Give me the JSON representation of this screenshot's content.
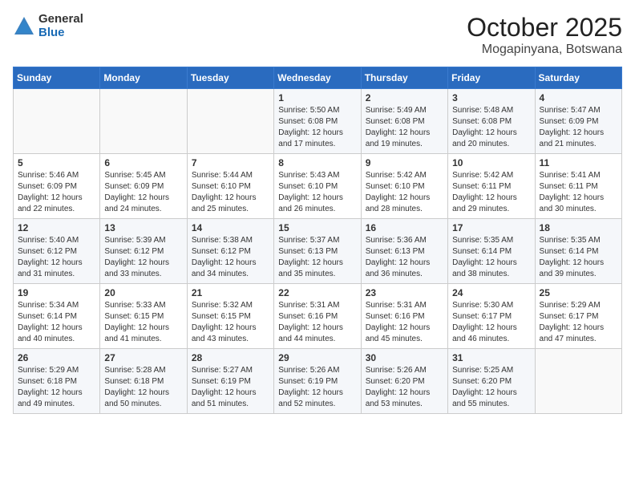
{
  "logo": {
    "general": "General",
    "blue": "Blue"
  },
  "header": {
    "month": "October 2025",
    "location": "Mogapinyana, Botswana"
  },
  "weekdays": [
    "Sunday",
    "Monday",
    "Tuesday",
    "Wednesday",
    "Thursday",
    "Friday",
    "Saturday"
  ],
  "weeks": [
    [
      {
        "day": "",
        "sunrise": "",
        "sunset": "",
        "daylight": ""
      },
      {
        "day": "",
        "sunrise": "",
        "sunset": "",
        "daylight": ""
      },
      {
        "day": "",
        "sunrise": "",
        "sunset": "",
        "daylight": ""
      },
      {
        "day": "1",
        "sunrise": "Sunrise: 5:50 AM",
        "sunset": "Sunset: 6:08 PM",
        "daylight": "Daylight: 12 hours and 17 minutes."
      },
      {
        "day": "2",
        "sunrise": "Sunrise: 5:49 AM",
        "sunset": "Sunset: 6:08 PM",
        "daylight": "Daylight: 12 hours and 19 minutes."
      },
      {
        "day": "3",
        "sunrise": "Sunrise: 5:48 AM",
        "sunset": "Sunset: 6:08 PM",
        "daylight": "Daylight: 12 hours and 20 minutes."
      },
      {
        "day": "4",
        "sunrise": "Sunrise: 5:47 AM",
        "sunset": "Sunset: 6:09 PM",
        "daylight": "Daylight: 12 hours and 21 minutes."
      }
    ],
    [
      {
        "day": "5",
        "sunrise": "Sunrise: 5:46 AM",
        "sunset": "Sunset: 6:09 PM",
        "daylight": "Daylight: 12 hours and 22 minutes."
      },
      {
        "day": "6",
        "sunrise": "Sunrise: 5:45 AM",
        "sunset": "Sunset: 6:09 PM",
        "daylight": "Daylight: 12 hours and 24 minutes."
      },
      {
        "day": "7",
        "sunrise": "Sunrise: 5:44 AM",
        "sunset": "Sunset: 6:10 PM",
        "daylight": "Daylight: 12 hours and 25 minutes."
      },
      {
        "day": "8",
        "sunrise": "Sunrise: 5:43 AM",
        "sunset": "Sunset: 6:10 PM",
        "daylight": "Daylight: 12 hours and 26 minutes."
      },
      {
        "day": "9",
        "sunrise": "Sunrise: 5:42 AM",
        "sunset": "Sunset: 6:10 PM",
        "daylight": "Daylight: 12 hours and 28 minutes."
      },
      {
        "day": "10",
        "sunrise": "Sunrise: 5:42 AM",
        "sunset": "Sunset: 6:11 PM",
        "daylight": "Daylight: 12 hours and 29 minutes."
      },
      {
        "day": "11",
        "sunrise": "Sunrise: 5:41 AM",
        "sunset": "Sunset: 6:11 PM",
        "daylight": "Daylight: 12 hours and 30 minutes."
      }
    ],
    [
      {
        "day": "12",
        "sunrise": "Sunrise: 5:40 AM",
        "sunset": "Sunset: 6:12 PM",
        "daylight": "Daylight: 12 hours and 31 minutes."
      },
      {
        "day": "13",
        "sunrise": "Sunrise: 5:39 AM",
        "sunset": "Sunset: 6:12 PM",
        "daylight": "Daylight: 12 hours and 33 minutes."
      },
      {
        "day": "14",
        "sunrise": "Sunrise: 5:38 AM",
        "sunset": "Sunset: 6:12 PM",
        "daylight": "Daylight: 12 hours and 34 minutes."
      },
      {
        "day": "15",
        "sunrise": "Sunrise: 5:37 AM",
        "sunset": "Sunset: 6:13 PM",
        "daylight": "Daylight: 12 hours and 35 minutes."
      },
      {
        "day": "16",
        "sunrise": "Sunrise: 5:36 AM",
        "sunset": "Sunset: 6:13 PM",
        "daylight": "Daylight: 12 hours and 36 minutes."
      },
      {
        "day": "17",
        "sunrise": "Sunrise: 5:35 AM",
        "sunset": "Sunset: 6:14 PM",
        "daylight": "Daylight: 12 hours and 38 minutes."
      },
      {
        "day": "18",
        "sunrise": "Sunrise: 5:35 AM",
        "sunset": "Sunset: 6:14 PM",
        "daylight": "Daylight: 12 hours and 39 minutes."
      }
    ],
    [
      {
        "day": "19",
        "sunrise": "Sunrise: 5:34 AM",
        "sunset": "Sunset: 6:14 PM",
        "daylight": "Daylight: 12 hours and 40 minutes."
      },
      {
        "day": "20",
        "sunrise": "Sunrise: 5:33 AM",
        "sunset": "Sunset: 6:15 PM",
        "daylight": "Daylight: 12 hours and 41 minutes."
      },
      {
        "day": "21",
        "sunrise": "Sunrise: 5:32 AM",
        "sunset": "Sunset: 6:15 PM",
        "daylight": "Daylight: 12 hours and 43 minutes."
      },
      {
        "day": "22",
        "sunrise": "Sunrise: 5:31 AM",
        "sunset": "Sunset: 6:16 PM",
        "daylight": "Daylight: 12 hours and 44 minutes."
      },
      {
        "day": "23",
        "sunrise": "Sunrise: 5:31 AM",
        "sunset": "Sunset: 6:16 PM",
        "daylight": "Daylight: 12 hours and 45 minutes."
      },
      {
        "day": "24",
        "sunrise": "Sunrise: 5:30 AM",
        "sunset": "Sunset: 6:17 PM",
        "daylight": "Daylight: 12 hours and 46 minutes."
      },
      {
        "day": "25",
        "sunrise": "Sunrise: 5:29 AM",
        "sunset": "Sunset: 6:17 PM",
        "daylight": "Daylight: 12 hours and 47 minutes."
      }
    ],
    [
      {
        "day": "26",
        "sunrise": "Sunrise: 5:29 AM",
        "sunset": "Sunset: 6:18 PM",
        "daylight": "Daylight: 12 hours and 49 minutes."
      },
      {
        "day": "27",
        "sunrise": "Sunrise: 5:28 AM",
        "sunset": "Sunset: 6:18 PM",
        "daylight": "Daylight: 12 hours and 50 minutes."
      },
      {
        "day": "28",
        "sunrise": "Sunrise: 5:27 AM",
        "sunset": "Sunset: 6:19 PM",
        "daylight": "Daylight: 12 hours and 51 minutes."
      },
      {
        "day": "29",
        "sunrise": "Sunrise: 5:26 AM",
        "sunset": "Sunset: 6:19 PM",
        "daylight": "Daylight: 12 hours and 52 minutes."
      },
      {
        "day": "30",
        "sunrise": "Sunrise: 5:26 AM",
        "sunset": "Sunset: 6:20 PM",
        "daylight": "Daylight: 12 hours and 53 minutes."
      },
      {
        "day": "31",
        "sunrise": "Sunrise: 5:25 AM",
        "sunset": "Sunset: 6:20 PM",
        "daylight": "Daylight: 12 hours and 55 minutes."
      },
      {
        "day": "",
        "sunrise": "",
        "sunset": "",
        "daylight": ""
      }
    ]
  ]
}
